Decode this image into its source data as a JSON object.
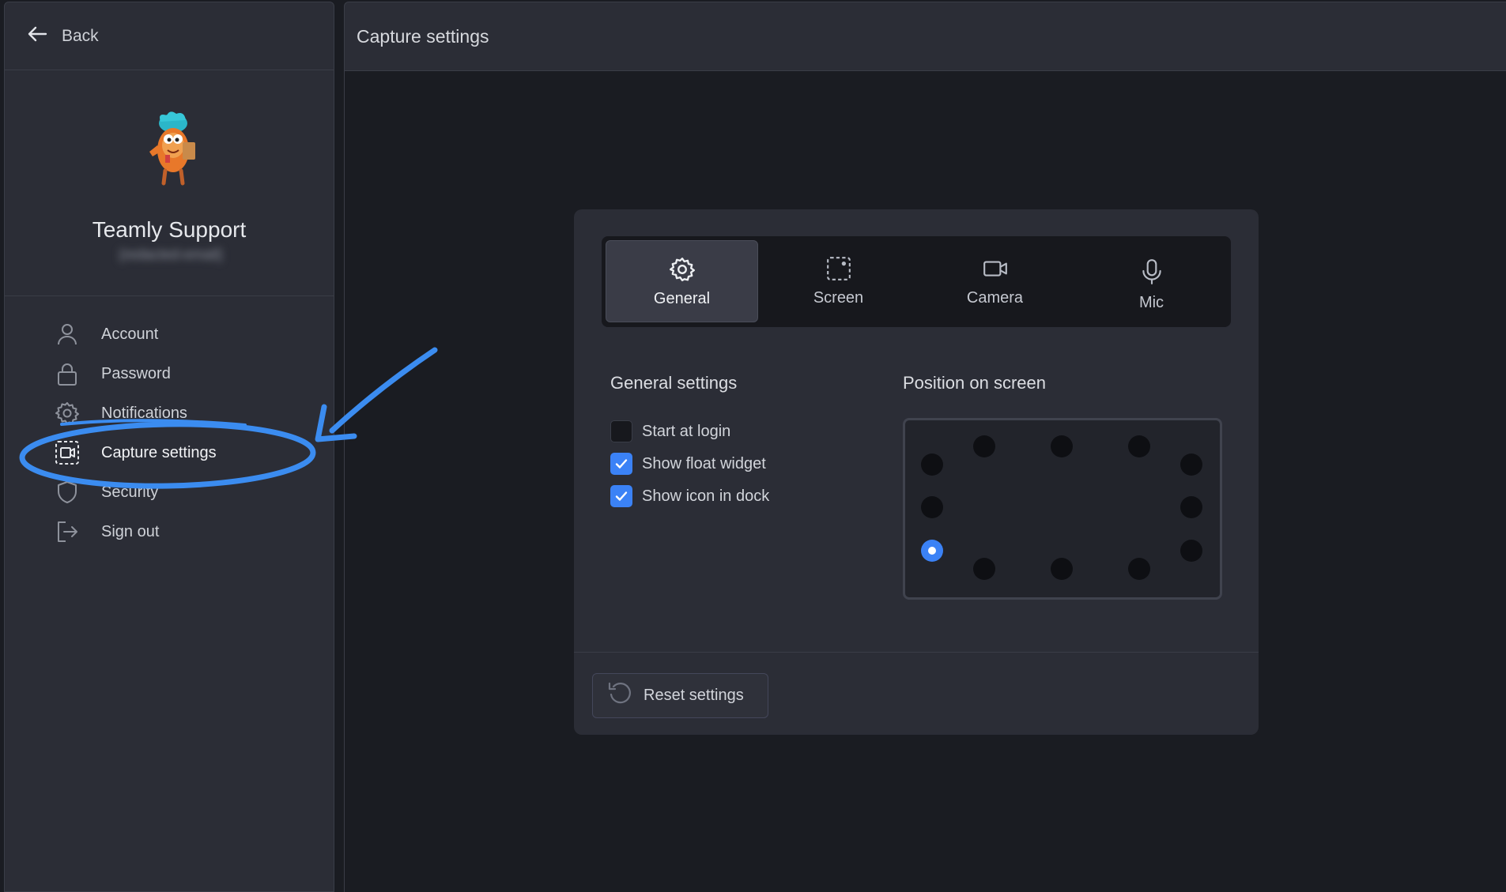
{
  "sidebar": {
    "back_label": "Back",
    "profile": {
      "name": "Teamly Support",
      "email": "{redacted-email}"
    },
    "items": [
      {
        "label": "Account",
        "icon": "user-icon"
      },
      {
        "label": "Password",
        "icon": "lock-icon"
      },
      {
        "label": "Notifications",
        "icon": "gear-icon"
      },
      {
        "label": "Capture settings",
        "icon": "capture-icon",
        "active": true
      },
      {
        "label": "Security",
        "icon": "shield-icon"
      },
      {
        "label": "Sign out",
        "icon": "sign-out-icon"
      }
    ]
  },
  "header": {
    "title": "Capture settings"
  },
  "panel": {
    "tabs": [
      {
        "label": "General",
        "icon": "gear-icon",
        "active": true
      },
      {
        "label": "Screen",
        "icon": "screen-select-icon"
      },
      {
        "label": "Camera",
        "icon": "camera-icon"
      },
      {
        "label": "Mic",
        "icon": "mic-icon"
      }
    ],
    "general_title": "General settings",
    "options": [
      {
        "label": "Start at login",
        "checked": false
      },
      {
        "label": "Show float widget",
        "checked": true
      },
      {
        "label": "Show icon in dock",
        "checked": true
      }
    ],
    "position_title": "Position on screen",
    "position_selected": "bottom-left",
    "reset_label": "Reset settings"
  },
  "colors": {
    "accent": "#3b82f6",
    "annotation": "#3b8cf0",
    "sidebar_bg": "#2b2d36",
    "page_bg": "#1a1c22"
  }
}
